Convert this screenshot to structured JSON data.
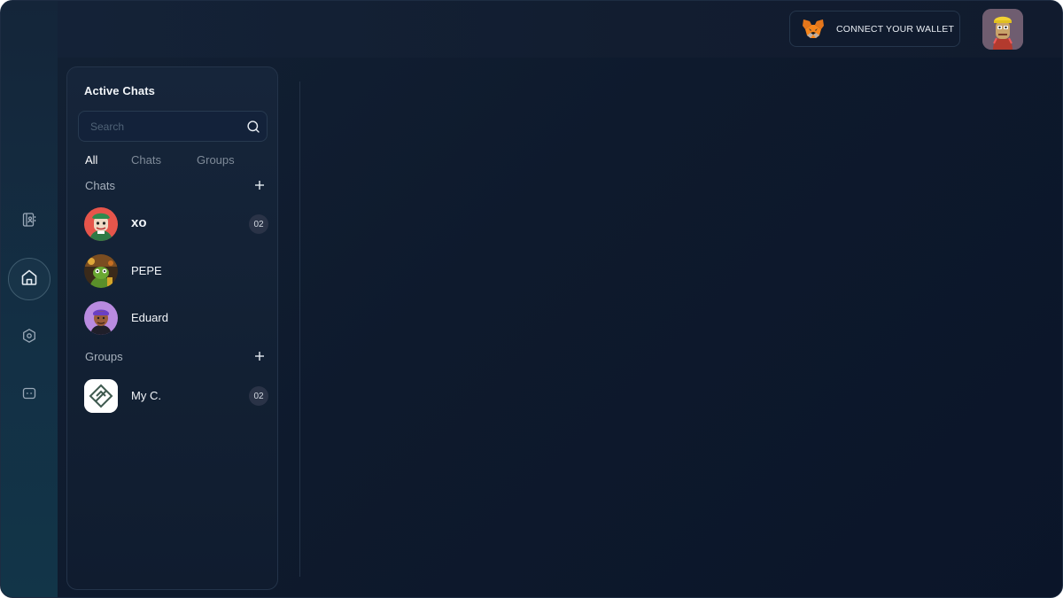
{
  "header": {
    "wallet_button_label": "CONNECT YOUR WALLET"
  },
  "sidebar_nav": {
    "items": [
      {
        "icon": "contacts-book-icon"
      },
      {
        "icon": "home-icon",
        "active": true
      },
      {
        "icon": "settings-hexagon-icon"
      },
      {
        "icon": "chat-bubble-icon"
      }
    ]
  },
  "chats_panel": {
    "title": "Active Chats",
    "search_placeholder": "Search",
    "tabs": [
      {
        "label": "All",
        "active": true
      },
      {
        "label": "Chats",
        "active": false
      },
      {
        "label": "Groups",
        "active": false
      }
    ],
    "chats_section_label": "Chats",
    "groups_section_label": "Groups",
    "chats": [
      {
        "name": "xo",
        "unread": "02"
      },
      {
        "name": "PEPE"
      },
      {
        "name": "Eduard"
      }
    ],
    "groups": [
      {
        "name": "My C.",
        "unread": "02"
      }
    ]
  },
  "colors": {
    "background": "#0e1a2d",
    "panel_border": "#24344a",
    "badge_bg": "#2a3347",
    "text_primary": "#f2f5f9",
    "text_muted": "#7f8b99"
  }
}
